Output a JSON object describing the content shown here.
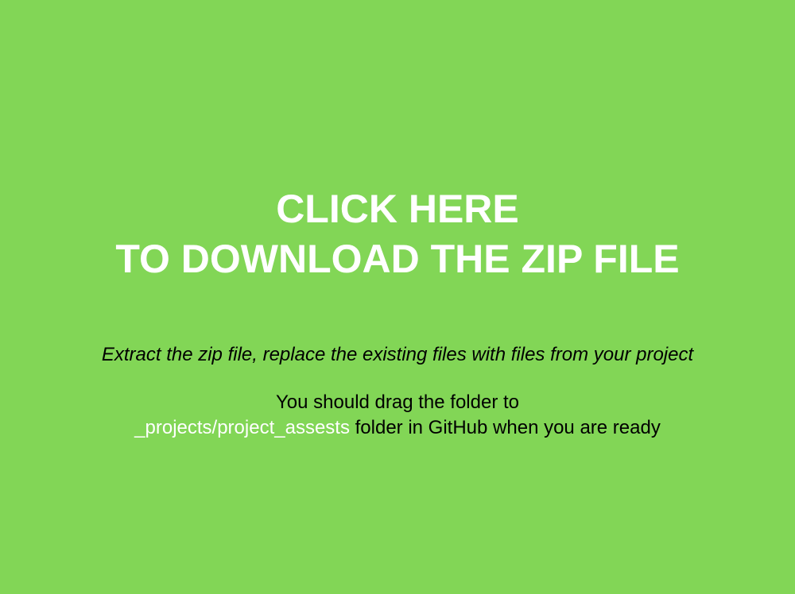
{
  "colors": {
    "background": "#82d656",
    "link": "#ffffff",
    "text": "#000000",
    "path_highlight": "#ffffff"
  },
  "download": {
    "line1": "CLICK HERE",
    "line2": "TO DOWNLOAD THE ZIP FILE"
  },
  "instruction": "Extract the zip file, replace the existing files with files from your project",
  "note": {
    "line1": "You should drag the folder to",
    "path": "_projects/project_assests",
    "line2_rest": " folder in GitHub when you are ready"
  }
}
